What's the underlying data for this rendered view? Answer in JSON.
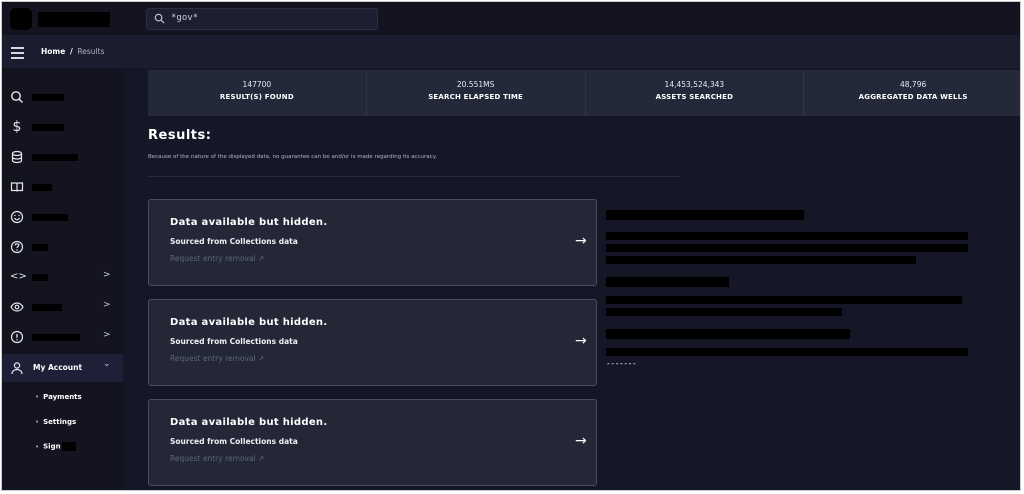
{
  "search": {
    "value": "*gov*"
  },
  "breadcrumb": {
    "home": "Home",
    "separator": "/",
    "current": "Results"
  },
  "sidebar": {
    "items": [
      {
        "icon": "search-icon",
        "glyph": "⚲"
      },
      {
        "icon": "dollar-icon",
        "glyph": "$"
      },
      {
        "icon": "database-icon",
        "glyph": "☰"
      },
      {
        "icon": "book-icon",
        "glyph": "▯"
      },
      {
        "icon": "smile-icon",
        "glyph": "☺"
      },
      {
        "icon": "help-icon",
        "glyph": "?"
      },
      {
        "icon": "code-icon",
        "glyph": "<>"
      },
      {
        "icon": "eye-icon",
        "glyph": "◉"
      },
      {
        "icon": "alert-icon",
        "glyph": "!"
      }
    ],
    "account": {
      "label": "My Account",
      "chevron": "⌄"
    },
    "submenu": {
      "payments": "Payments",
      "settings": "Settings",
      "sign": "Sign"
    }
  },
  "stats": [
    {
      "value": "147700",
      "label": "RESULT(S) FOUND"
    },
    {
      "value": "20.551MS",
      "label": "SEARCH ELAPSED TIME"
    },
    {
      "value": "14,453,524,343",
      "label": "ASSETS SEARCHED"
    },
    {
      "value": "48,796",
      "label": "AGGREGATED DATA WELLS"
    }
  ],
  "results": {
    "title": "Results:",
    "note": "Because of the nature of the displayed data, no guarantee can be and/or is made regarding its accuracy.",
    "cards": [
      {
        "title": "Data available but hidden.",
        "source": "Sourced from Collections data",
        "removal": "Request entry removal ↗"
      },
      {
        "title": "Data available but hidden.",
        "source": "Sourced from Collections data",
        "removal": "Request entry removal ↗"
      },
      {
        "title": "Data available but hidden.",
        "source": "Sourced from Collections data",
        "removal": "Request entry removal ↗"
      }
    ]
  },
  "side_panel": {
    "trailing": "-------"
  }
}
